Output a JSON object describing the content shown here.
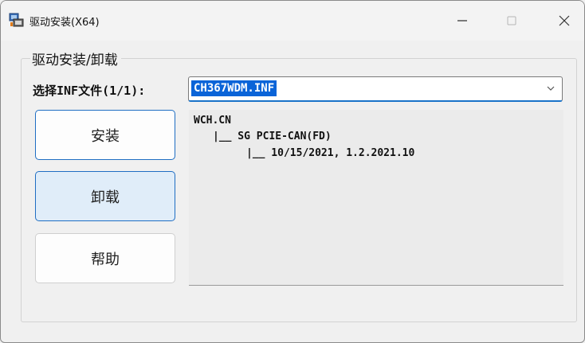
{
  "window": {
    "title": "驱动安装(X64)",
    "icon": "driver-setup-icon"
  },
  "group": {
    "title": "驱动安装/卸载"
  },
  "inf": {
    "label": "选择INF文件(1/1):",
    "value": "CH367WDM.INF"
  },
  "buttons": {
    "install": "安装",
    "uninstall": "卸载",
    "help": "帮助"
  },
  "tree": {
    "line1": "WCH.CN",
    "line2": "|__ SG PCIE-CAN(FD)",
    "line3": "|__ 10/15/2021, 1.2.2021.10"
  },
  "colors": {
    "accent": "#1f6ec3",
    "selection": "#0a64d8"
  }
}
